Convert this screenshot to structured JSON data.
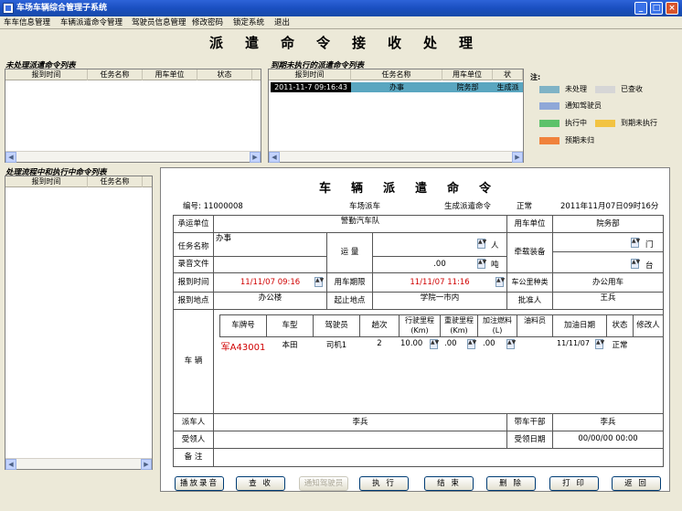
{
  "window": {
    "title": "车场车辆综合管理子系统",
    "min": "_",
    "max": "□",
    "close": "×"
  },
  "menu": [
    "车车信息管理",
    "车辆派遣命令管理",
    "驾驶员信息管理",
    "修改密码",
    "锁定系统",
    "退出"
  ],
  "page_title": "派遣命令接收处理",
  "unprocessed": {
    "label": "未处理派遣命令列表",
    "headers": [
      "报到时间",
      "任务名称",
      "用车单位",
      "状态"
    ]
  },
  "expired": {
    "label": "到期未执行的派遣命令列表",
    "headers": [
      "报到时间",
      "任务名称",
      "用车单位",
      "状"
    ],
    "rows": [
      [
        "2011-11-7 09:16:43",
        "办事",
        "院务部",
        "生成派"
      ]
    ]
  },
  "legend": {
    "title": "注:",
    "items": [
      {
        "text": "未处理",
        "color": "#7fb3c6"
      },
      {
        "text": "已查收",
        "color": "#d6d6d6"
      },
      {
        "text": "通知驾驶员",
        "color": "#8fa8d8"
      },
      {
        "text": "执行中",
        "color": "#5cc26a"
      },
      {
        "text": "到期未执行",
        "color": "#f2c342"
      },
      {
        "text": "预期未归",
        "color": "#f0823c"
      }
    ]
  },
  "processing": {
    "label": "处理流程中和执行中命令列表",
    "headers": [
      "报到时间",
      "任务名称"
    ]
  },
  "form": {
    "heading": "车辆派遣命令",
    "no_label": "编号:",
    "no": "11000008",
    "fleet": "车场派车",
    "state_text": "生成派遣命令",
    "state": "正常",
    "datetime": "2011年11月07日09时16分",
    "carrier_label": "承运单位",
    "carrier": "警勤汽车队",
    "user_unit_label": "用车单位",
    "user_unit": "院务部",
    "task_label": "任务名称",
    "task": "办事",
    "volume_label": "运 量",
    "person_unit": "人",
    "ton": ".00",
    "ton_unit": "吨",
    "tow_label": "牵载装备",
    "door_unit": "门",
    "set_unit": "台",
    "audio_label": "录音文件",
    "report_time_label": "报到时间",
    "report_time": "11/11/07 09:16",
    "deadline_label": "用车期限",
    "deadline": "11/11/07 11:16",
    "car_type_label": "车公里种类",
    "car_type": "办公用车",
    "report_place_label": "报到地点",
    "report_place": "办公楼",
    "start_place_label": "起止地点",
    "start_place": "学院一市内",
    "approver_label": "批准人",
    "approver": "王兵",
    "vehicle_label": "车 辆",
    "vh": [
      "车牌号",
      "车型",
      "驾驶员",
      "趟次",
      "行驶里程(Km)",
      "重驶里程(Km)",
      "加注燃料(L)",
      "油料员",
      "加油日期",
      "状态",
      "修改人"
    ],
    "vr": [
      "军A43001",
      "本田",
      "司机1",
      "2",
      "10.00",
      ".00",
      ".00",
      "",
      "11/11/07",
      "正常",
      ""
    ],
    "dispatcher_label": "派车人",
    "dispatcher": "李兵",
    "car_cadre_label": "带车干部",
    "car_cadre": "李兵",
    "receiver_label": "受领人",
    "receive_date_label": "受领日期",
    "receive_date": "00/00/00 00:00",
    "remark_label": "备 注"
  },
  "buttons": [
    "播放录音",
    "查 收",
    "通知驾驶员",
    "执 行",
    "结 束",
    "删 除",
    "打 印",
    "返 回"
  ]
}
